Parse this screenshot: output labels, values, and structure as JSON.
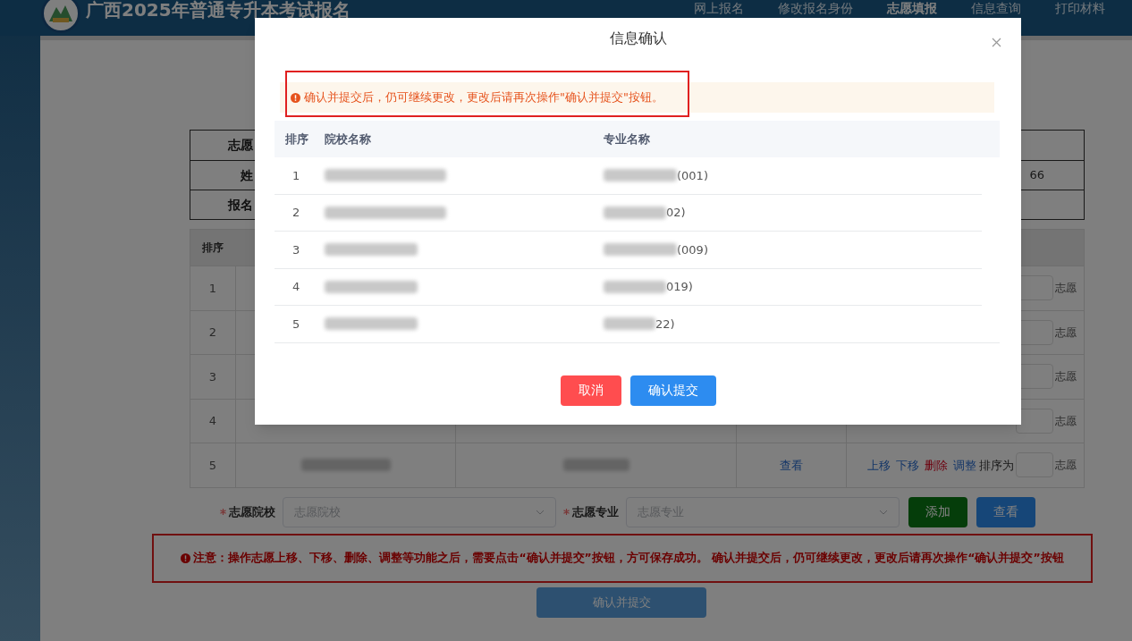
{
  "header": {
    "title": "广西2025年普通专升本考试报名",
    "nav": [
      {
        "label": "网上报名",
        "selected": false
      },
      {
        "label": "修改报名身份",
        "selected": false
      },
      {
        "label": "志愿填报",
        "selected": true
      },
      {
        "label": "信息查询",
        "selected": false
      },
      {
        "label": "打印材料",
        "selected": false
      }
    ]
  },
  "info_table": {
    "rows": [
      {
        "label": "志愿"
      },
      {
        "label": "姓",
        "value": "66"
      },
      {
        "label": "报名"
      }
    ]
  },
  "choices_table": {
    "header": "排序",
    "rows": [
      {
        "index": "1",
        "suffix": "志愿"
      },
      {
        "index": "2",
        "suffix": "志愿"
      },
      {
        "index": "3",
        "suffix": "志愿"
      },
      {
        "index": "4",
        "suffix": "志愿"
      },
      {
        "index": "5",
        "view": "查看",
        "actions": [
          {
            "label": "上移",
            "kind": "link"
          },
          {
            "label": "下移",
            "kind": "link"
          },
          {
            "label": "删除",
            "kind": "danger"
          },
          {
            "label": "调整",
            "kind": "link"
          }
        ],
        "order_label": "排序为",
        "suffix": "志愿"
      }
    ]
  },
  "form": {
    "fields": [
      {
        "label": "志愿院校",
        "required": true,
        "placeholder": "志愿院校"
      },
      {
        "label": "志愿专业",
        "required": true,
        "placeholder": "志愿专业"
      }
    ],
    "buttons": [
      {
        "label": "添加",
        "kind": "success"
      },
      {
        "label": "查看",
        "kind": "primary"
      }
    ]
  },
  "notice": "注意：操作志愿上移、下移、删除、调整等功能之后，需要点击“确认并提交”按钮，方可保存成功。 确认并提交后，仍可继续更改，更改后请再次操作“确认并提交”按钮",
  "submit_button": "确认并提交",
  "modal": {
    "title": "信息确认",
    "alert": "确认并提交后，仍可继续更改，更改后请再次操作\"确认并提交\"按钮。",
    "columns": [
      "排序",
      "院校名称",
      "专业名称"
    ],
    "rows": [
      {
        "index": "1",
        "major_suffix": "(001)"
      },
      {
        "index": "2",
        "major_suffix": "02)"
      },
      {
        "index": "3",
        "major_suffix": "(009)"
      },
      {
        "index": "4",
        "major_suffix": "019)"
      },
      {
        "index": "5",
        "major_suffix": "22)"
      }
    ],
    "buttons": [
      {
        "label": "取消",
        "kind": "danger"
      },
      {
        "label": "确认提交",
        "kind": "primary"
      }
    ]
  }
}
